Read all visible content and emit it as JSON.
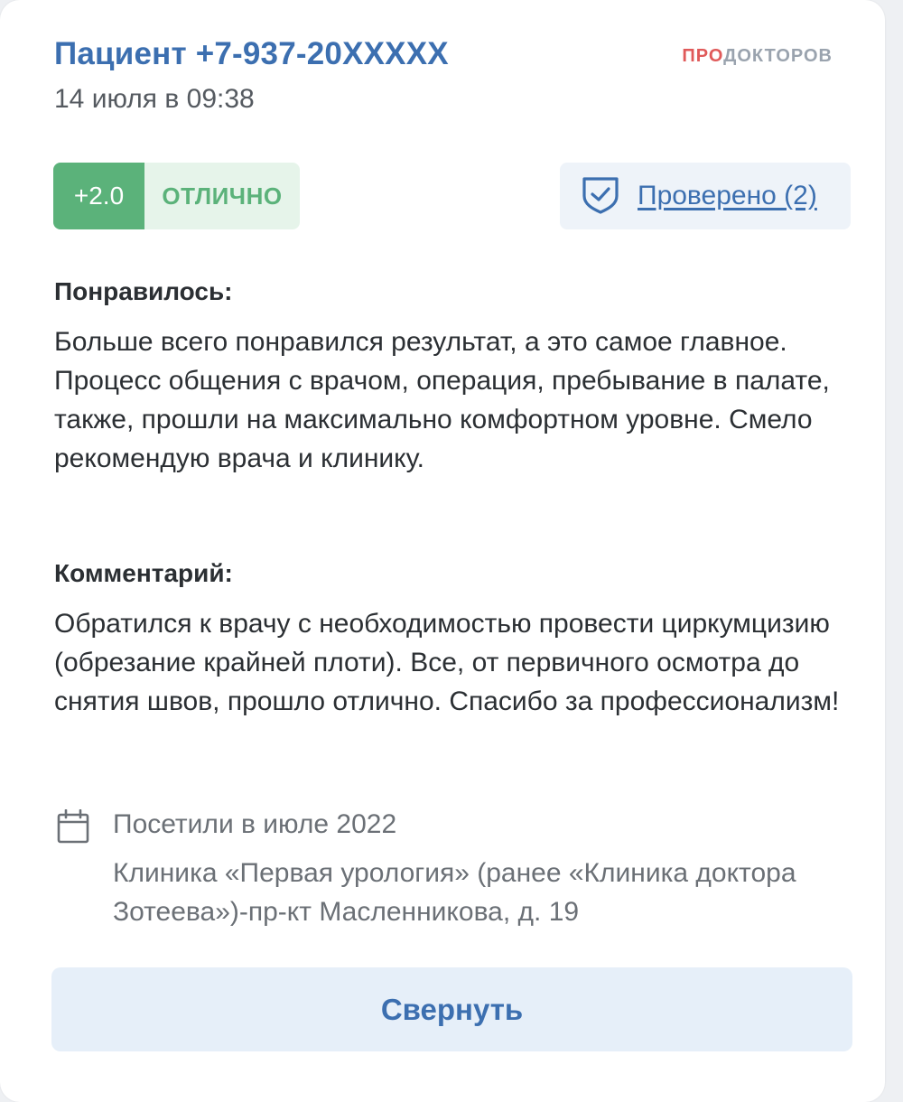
{
  "review": {
    "author": "Пациент +7-937-20XXXXX",
    "date": "14 июля в 09:38",
    "logo": {
      "pro": "ПРО",
      "rest": "ДОКТОРОВ"
    },
    "rating": {
      "score": "+2.0",
      "word": "ОТЛИЧНО"
    },
    "verified": "Проверено (2)",
    "liked_heading": "Понравилось:",
    "liked_text": "Больше всего понравился результат, а это самое главное. Процесс общения с врачом, операция, пребывание в палате, также, прошли на максимально комфортном уровне. Смело рекомендую врача и клинику.",
    "comment_heading": "Комментарий:",
    "comment_text": "Обратился к врачу с необходимостью провести циркумцизию (обрезание крайней плоти). Все, от первичного осмотра до снятия швов, прошло отлично. Спасибо за профессионализм!",
    "visit_date": "Посетили в июле 2022",
    "clinic": "Клиника «Первая урология» (ранее «Клиника доктора Зотеева»)-пр-кт Масленникова, д. 19",
    "collapse_label": "Свернуть"
  },
  "icons": [
    "shield-check-icon",
    "calendar-icon"
  ],
  "colors": {
    "link_blue": "#3c6fb0",
    "rating_green": "#5bb27a",
    "rating_bg": "#e6f4ea",
    "verified_bg": "#eef3f9",
    "button_bg": "#e6eff9",
    "logo_red": "#e05a5a"
  }
}
